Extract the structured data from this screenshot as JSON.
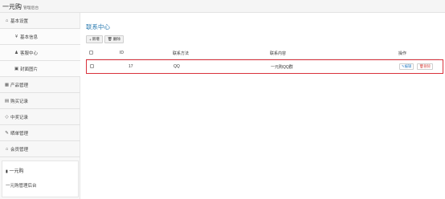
{
  "header": {
    "brand": "一元购",
    "subtitle": "管理后台"
  },
  "sidebar": {
    "items": [
      {
        "label": "基本设置",
        "icon": "home-icon"
      },
      {
        "label": "基本信息",
        "icon": "yen-icon"
      },
      {
        "label": "客服中心",
        "icon": "users-icon"
      },
      {
        "label": "封面图片",
        "icon": "image-icon"
      },
      {
        "label": "产品管理",
        "icon": "gift-icon"
      },
      {
        "label": "购买记录",
        "icon": "cart-icon"
      },
      {
        "label": "中奖记录",
        "icon": "diamond-icon"
      },
      {
        "label": "晒单管理",
        "icon": "edit-icon"
      },
      {
        "label": "会员管理",
        "icon": "home-icon"
      }
    ],
    "user": {
      "name": "一元购",
      "description": "一元购管理后台"
    }
  },
  "main": {
    "title": "联系中心",
    "toolbar": {
      "add_label": "新增",
      "delete_label": "删除"
    },
    "table": {
      "columns": [
        "ID",
        "联系方法",
        "联系内容",
        "操作"
      ],
      "rows": [
        {
          "id": "17",
          "method": "QQ",
          "content": "一元购QQ群",
          "edit_label": "编辑",
          "delete_label": "删除"
        }
      ]
    }
  },
  "colors": {
    "accent": "#2a7ab0",
    "highlight_border": "#d9313b",
    "delete": "#d9534f"
  }
}
